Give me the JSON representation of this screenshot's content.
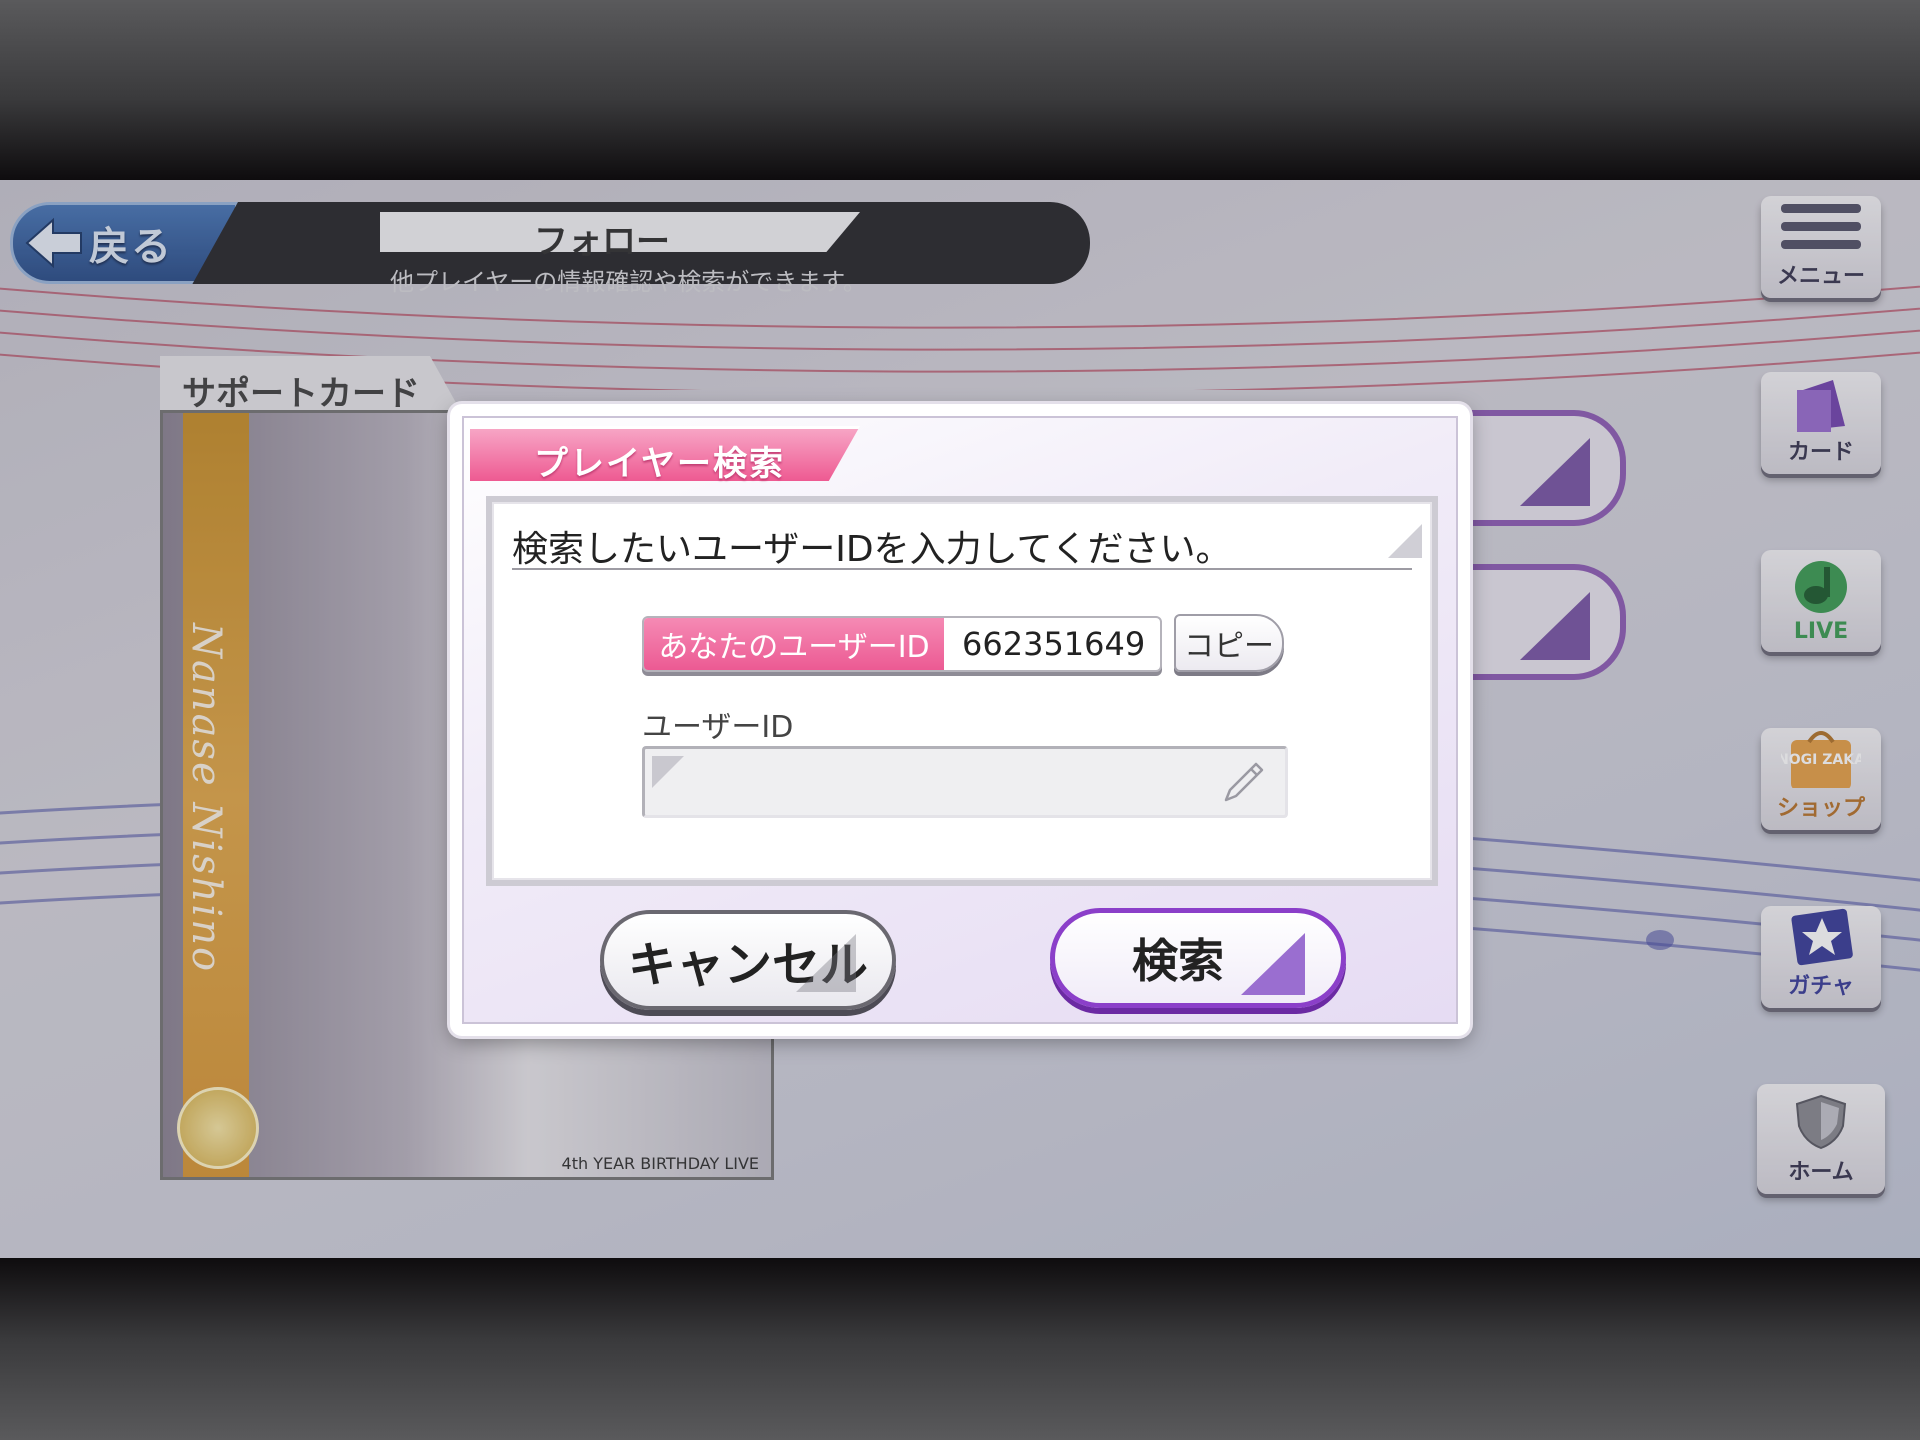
{
  "header": {
    "back_label": "戻る",
    "title": "フォロー",
    "subtitle": "他プレイヤーの情報確認や検索ができます。"
  },
  "side_menu": [
    {
      "label": "メニュー",
      "icon": "hamburger-icon"
    },
    {
      "label": "カード",
      "icon": "card-icon"
    },
    {
      "label": "LIVE",
      "icon": "live-icon"
    },
    {
      "label": "ショップ",
      "icon": "shop-bag-icon",
      "icon_text": "NOGI ZAKA"
    },
    {
      "label": "ガチャ",
      "icon": "gacha-star-icon"
    },
    {
      "label": "ホーム",
      "icon": "home-shield-icon"
    }
  ],
  "support_card": {
    "tab_label": "サポートカード",
    "member_name": "Nanase Nishino",
    "event_label": "4th YEAR BIRTHDAY LIVE"
  },
  "dialog": {
    "title": "プレイヤー検索",
    "instruction": "検索したいユーザーIDを入力してください。",
    "my_id_label": "あなたのユーザーID",
    "my_id_value": "662351649",
    "copy_label": "コピー",
    "field_label": "ユーザーID",
    "field_value": "",
    "field_placeholder": "",
    "cancel_label": "キャンセル",
    "search_label": "検索"
  },
  "colors": {
    "accent_pink": "#ee5a92",
    "accent_purple": "#8b3fc9",
    "back_blue": "#2c4f8a"
  }
}
